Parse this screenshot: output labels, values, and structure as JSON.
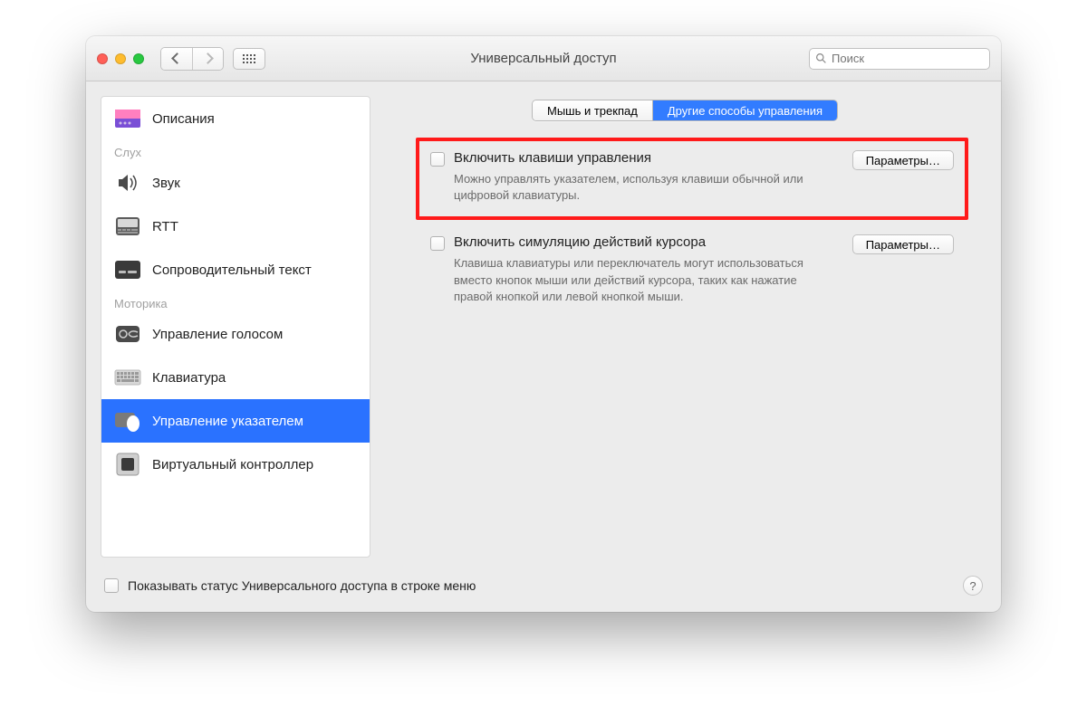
{
  "window": {
    "title": "Универсальный доступ"
  },
  "search": {
    "placeholder": "Поиск"
  },
  "sidebar": {
    "cat_hearing": "Слух",
    "cat_motor": "Моторика",
    "items": {
      "descriptions": "Описания",
      "sound": "Звук",
      "rtt": "RTT",
      "captions": "Сопроводительный текст",
      "voice": "Управление голосом",
      "keyboard": "Клавиатура",
      "pointer": "Управление указателем",
      "switch": "Виртуальный контроллер"
    }
  },
  "tabs": {
    "mouse": "Мышь и трекпад",
    "alt": "Другие способы управления"
  },
  "opt1": {
    "title": "Включить клавиши управления",
    "desc": "Можно управлять указателем, используя клавиши обычной или цифровой клавиатуры.",
    "btn": "Параметры…"
  },
  "opt2": {
    "title": "Включить симуляцию действий курсора",
    "desc": "Клавиша клавиатуры или переключатель могут использоваться вместо кнопок мыши или действий курсора, таких как нажатие правой кнопкой или левой кнопкой мыши.",
    "btn": "Параметры…"
  },
  "footer": {
    "label": "Показывать статус Универсального доступа в строке меню"
  },
  "help": "?"
}
